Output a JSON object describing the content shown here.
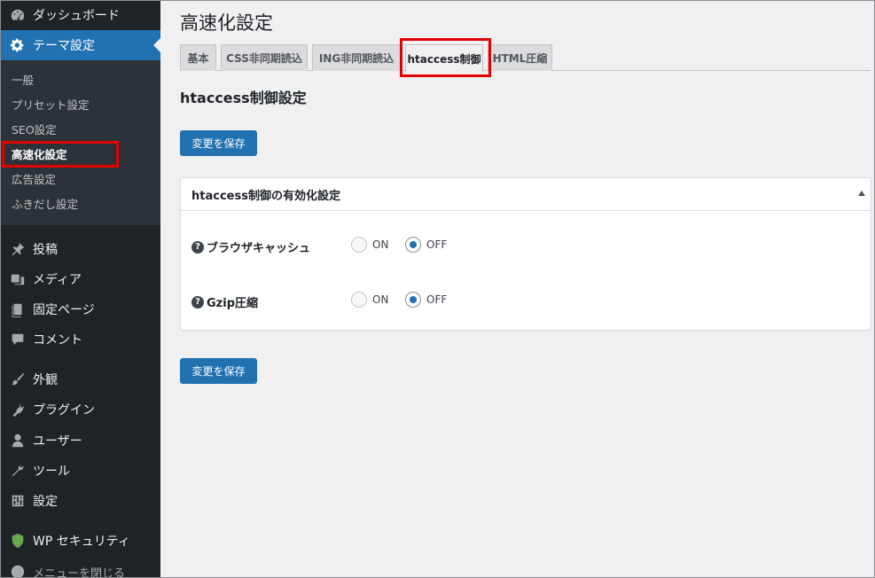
{
  "sidebar": {
    "dashboard": "ダッシュボード",
    "theme_settings": "テーマ設定",
    "submenu": [
      "一般",
      "プリセット設定",
      "SEO設定",
      "高速化設定",
      "広告設定",
      "ふきだし設定"
    ],
    "posts": "投稿",
    "media": "メディア",
    "pages": "固定ページ",
    "comments": "コメント",
    "appearance": "外観",
    "plugins": "プラグイン",
    "users": "ユーザー",
    "tools": "ツール",
    "settings": "設定",
    "wp_security": "WP セキュリティ",
    "collapse_menu": "メニューを閉じる"
  },
  "main": {
    "page_title": "高速化設定",
    "tabs": [
      "基本",
      "CSS非同期読込",
      "ING非同期読込",
      "htaccess制御",
      "HTML圧縮"
    ],
    "active_tab": "htaccess制御",
    "section_title": "htaccess制御設定",
    "save_button": "変更を保存",
    "panel": {
      "title": "htaccess制御の有効化設定",
      "rows": [
        {
          "label": "ブラウザキャッシュ",
          "on": "ON",
          "off": "OFF",
          "selected": "OFF"
        },
        {
          "label": "Gzip圧縮",
          "on": "ON",
          "off": "OFF",
          "selected": "OFF"
        }
      ]
    }
  },
  "colors": {
    "accent": "#2271b1",
    "sidebar_bg": "#1d2327",
    "highlight": "#e00000"
  }
}
